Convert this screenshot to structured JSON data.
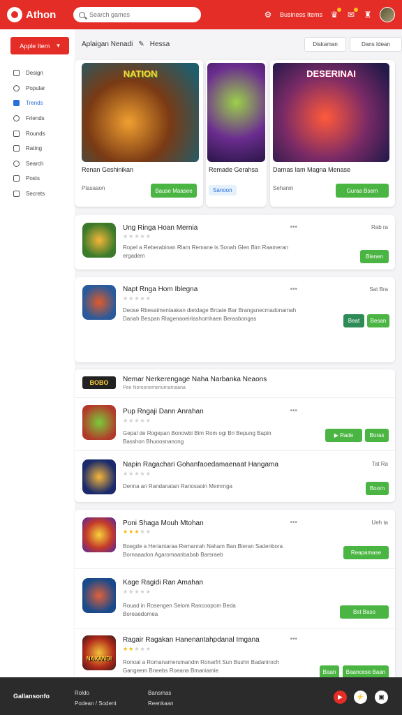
{
  "header": {
    "app_name": "Athon",
    "search_placeholder": "Search games",
    "user_label": "Business Items",
    "colors": {
      "accent": "#e52d27",
      "success": "#4bb543"
    }
  },
  "sidebar": {
    "category_button": "Apple Item",
    "items": [
      {
        "label": "Design",
        "icon": "home-icon",
        "active": false
      },
      {
        "label": "Popular",
        "icon": "clock-icon",
        "active": false
      },
      {
        "label": "Trends",
        "icon": "trend-icon",
        "active": true
      },
      {
        "label": "Friends",
        "icon": "user-icon",
        "active": false
      },
      {
        "label": "Rounds",
        "icon": "book-icon",
        "active": false
      },
      {
        "label": "Rating",
        "icon": "list-icon",
        "active": false
      },
      {
        "label": "Search",
        "icon": "person-icon",
        "active": false
      },
      {
        "label": "Posts",
        "icon": "note-icon",
        "active": false
      },
      {
        "label": "Secrets",
        "icon": "box-icon",
        "active": false
      }
    ]
  },
  "main": {
    "title": "Aplaigan Nenadi",
    "title_tag": "Hessa",
    "pill_1": "Diskaman",
    "pill_2": "Dans Idean",
    "featured": [
      {
        "banner": "NATION",
        "title": "Renan Geshinikan",
        "meta": "Plasaaon",
        "button": "Bause Maasee"
      },
      {
        "title": "Remade Gerahsa",
        "meta": "Sanoon"
      },
      {
        "banner": "DESERINAI",
        "title": "Darnas Iam Magna Menase",
        "meta": "Sehanin",
        "button": "Guraa Bsem"
      }
    ],
    "list_a": [
      {
        "title": "Ung Ringa Hoan Mernia",
        "desc": "Ropel a Reberabinan Rlam Remane is Sonah Glen Bim Raameran ergadem",
        "price": "Rab ra",
        "button": "Bienen",
        "stars": 0
      }
    ],
    "list_b": [
      {
        "title": "Napt Rnga Hom Iblegna",
        "desc": "Deose Rbesaimentaakan dietdage Broate Bar Brangsnecmadonamah Danah Bespan Rlagenaoeirlashomhaen Berasbongas",
        "price": "Sat Bra",
        "button_1": "Beat",
        "button_2": "Besan",
        "stars": 0
      }
    ],
    "group_c": {
      "logo": "BOBO",
      "title": "Nemar Nerkerengage Naha Narbanka Neaons",
      "subtitle": "Pee Noroonemenumamaana",
      "items": [
        {
          "title": "Pup Rngaji Dann Anrahan",
          "desc": "Gepal de Rogepan Bonowbi Bim Rom ogi Bri Bepung Bapin Basshon Bhuoosnanong",
          "button_1": "Rade",
          "button_2": "Boras",
          "stars": 0
        },
        {
          "title": "Napin Ragachari Gohanfaoedamaenaat Hangama",
          "desc": "Denna an Randanatan Ranosaoin Memrnga",
          "price": "Tat Ra",
          "button": "Boorn",
          "stars": 0
        }
      ]
    },
    "group_d": {
      "items": [
        {
          "title": "Poni Shaga Mouh Mtohan",
          "desc": "Boegde a Heriantaraa Remanrah Naham Ban Bieran Sadenbora Bornaaadon Agaromaanbabab Barsraeb",
          "price": "Ueh ta",
          "button": "Reapamase",
          "stars": 3
        },
        {
          "title": "Kage Ragidi Ran Amahan",
          "desc": "Rouad in Rosengen Selom Rancoopom Beda Boreaedomea",
          "button": "Bst Baso",
          "stars": 0
        },
        {
          "title": "Ragair Ragakan Hanenantahpdanal Imgana",
          "desc": "Ronoal a Romanamersmandm Ronarfrt Sun Bushn Badaniroch Gangeem Bneebs Roeana Bmaniamie",
          "button_1": "Baan",
          "button_2": "Baancese Baan",
          "stars": 2,
          "banner": "NAXANDI"
        }
      ]
    }
  },
  "footer": {
    "brand": "Gallansonfo",
    "col1_title": "Roldo",
    "col1_sub": "Podean / Sodent",
    "col2_title": "Bansmas",
    "col2_sub": "Reenkaan"
  }
}
